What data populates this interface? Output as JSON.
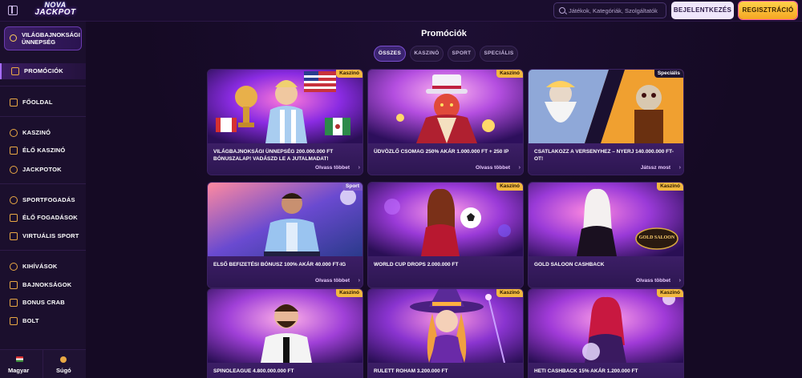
{
  "header": {
    "logo_line1": "NOVA",
    "logo_line2": "JACKPOT",
    "search_placeholder": "Játékok, Kategóriák, Szolgáltatók",
    "login_label": "BEJELENTKEZÉS",
    "register_label": "REGISZTRÁCIÓ"
  },
  "sidebar": {
    "event_label": "VILÁGBAJNOKSÁGI ÜNNEPSÉG",
    "items": [
      {
        "label": "PROMÓCIÓK",
        "icon": "gift-icon",
        "active": true
      },
      {
        "label": "FŐOLDAL",
        "icon": "home-icon"
      },
      {
        "label": "KASZINÓ",
        "icon": "chip-icon"
      },
      {
        "label": "ÉLŐ KASZINÓ",
        "icon": "live-icon"
      },
      {
        "label": "JACKPOTOK",
        "icon": "coin-icon"
      },
      {
        "label": "SPORTFOGADÁS",
        "icon": "ball-icon"
      },
      {
        "label": "ÉLŐ FOGADÁSOK",
        "icon": "live-bet-icon"
      },
      {
        "label": "VIRTUÁLIS SPORT",
        "icon": "virtual-sport-icon"
      },
      {
        "label": "KIHÍVÁSOK",
        "icon": "target-icon"
      },
      {
        "label": "BAJNOKSÁGOK",
        "icon": "trophy-icon"
      },
      {
        "label": "BONUS CRAB",
        "icon": "crab-icon"
      },
      {
        "label": "BOLT",
        "icon": "shop-icon"
      }
    ],
    "language_label": "Magyar",
    "help_label": "Súgó"
  },
  "main": {
    "title": "Promóciók",
    "filters": [
      "ÖSSZES",
      "KASZINÓ",
      "SPORT",
      "SPECIÁLIS"
    ],
    "cards": [
      {
        "tag": "Kaszinó",
        "title": "VILÁGBAJNOKSÁGI ÜNNEPSÉG 200.000.000 FT BÓNUSZALAP! VADÁSZD LE A JUTALMADAT!",
        "link": "Olvass többet"
      },
      {
        "tag": "Kaszinó",
        "title": "ÜDVÖZLŐ CSOMAG 250% AKÁR 1.000.000 FT + 250 IP",
        "link": "Olvass többet"
      },
      {
        "tag": "Speciális",
        "title": "CSATLAKOZZ A VERSENYHEZ – NYERJ 140.000.000 FT-OT!",
        "link": "Játssz most"
      },
      {
        "tag": "Sport",
        "title": "ELSŐ BEFIZETÉSI BÓNUSZ 100% AKÁR 40.000 FT-IG",
        "link": "Olvass többet"
      },
      {
        "tag": "Kaszinó",
        "title": "WORLD CUP DROPS 2.000.000 FT",
        "link": ""
      },
      {
        "tag": "Kaszinó",
        "title": "GOLD SALOON CASHBACK",
        "link": "Olvass többet",
        "badge": "GOLD SALOON"
      },
      {
        "tag": "Kaszinó",
        "title": "SPINOLEAGUE 4.800.000.000 FT",
        "link": ""
      },
      {
        "tag": "Kaszinó",
        "title": "RULETT ROHAM 3.200.000 FT",
        "link": ""
      },
      {
        "tag": "Kaszinó",
        "title": "HETI CASHBACK 15% AKÁR 1.200.000 FT",
        "link": ""
      }
    ]
  },
  "colors": {
    "background": "#150a24",
    "accent": "#a66cff",
    "register": "#f5a623",
    "tag": "#f2b840"
  }
}
